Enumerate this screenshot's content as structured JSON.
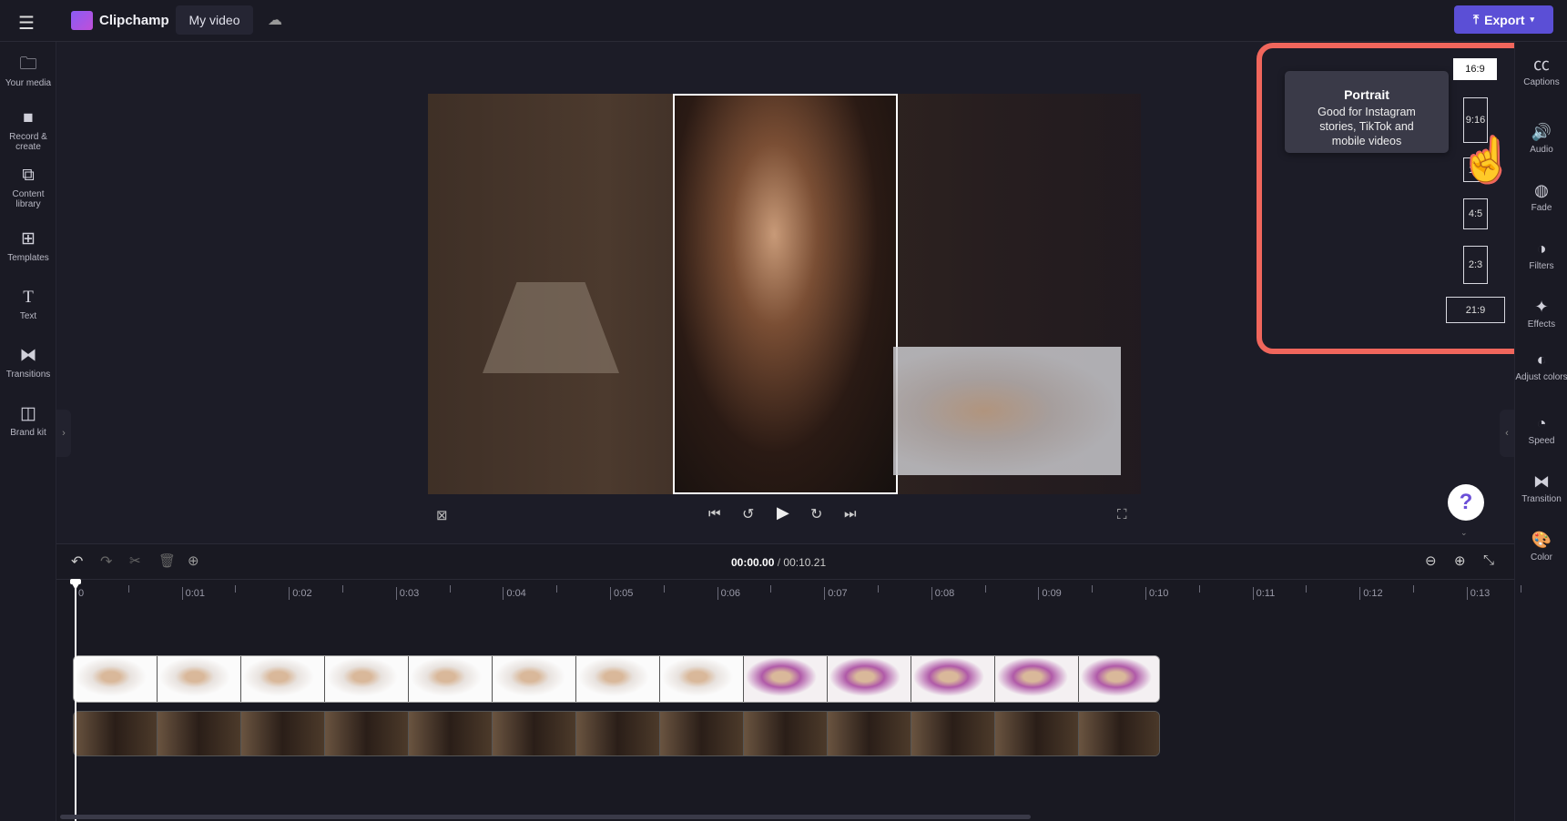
{
  "topbar": {
    "app_name": "Clipchamp",
    "project_title": "My video",
    "export_label": "Export",
    "accent": "#5b4fd6"
  },
  "left_sidebar": {
    "items": [
      {
        "label": "Your media",
        "icon": "folder-icon"
      },
      {
        "label": "Record & create",
        "icon": "video-camera-icon"
      },
      {
        "label": "Content library",
        "icon": "content-library-icon"
      },
      {
        "label": "Templates",
        "icon": "templates-icon"
      },
      {
        "label": "Text",
        "icon": "text-icon"
      },
      {
        "label": "Transitions",
        "icon": "transitions-icon"
      },
      {
        "label": "Brand kit",
        "icon": "brand-kit-icon"
      }
    ]
  },
  "right_sidebar": {
    "items": [
      {
        "label": "Captions",
        "icon": "captions-icon"
      },
      {
        "label": "Audio",
        "icon": "audio-icon"
      },
      {
        "label": "Fade",
        "icon": "fade-icon"
      },
      {
        "label": "Filters",
        "icon": "filters-icon"
      },
      {
        "label": "Effects",
        "icon": "effects-icon"
      },
      {
        "label": "Adjust colors",
        "icon": "adjust-colors-icon"
      },
      {
        "label": "Speed",
        "icon": "speed-icon"
      },
      {
        "label": "Transition",
        "icon": "transition-icon"
      },
      {
        "label": "Color",
        "icon": "color-palette-icon"
      }
    ]
  },
  "aspect_ratio": {
    "options": [
      "16:9",
      "9:16",
      "1:1",
      "4:5",
      "2:3",
      "21:9"
    ],
    "selected": "16:9",
    "hovered": "9:16",
    "tooltip": {
      "title": "Portrait",
      "body": "Good for Instagram stories, TikTok and mobile videos"
    },
    "highlight_color": "#f0665c"
  },
  "timeline": {
    "current_time": "00:00.00",
    "separator": "/",
    "total_time": "00:10.21",
    "ruler": [
      "0",
      "0:01",
      "0:02",
      "0:03",
      "0:04",
      "0:05",
      "0:06",
      "0:07",
      "0:08",
      "0:09",
      "0:10",
      "0:11",
      "0:12",
      "0:13"
    ]
  },
  "help": {
    "label": "?"
  }
}
